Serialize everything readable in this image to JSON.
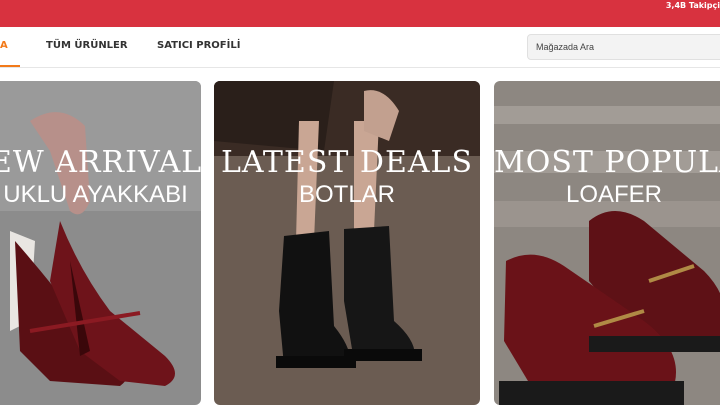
{
  "header": {
    "followers": "3,4B Takipçi",
    "brand_color": "#d8323f",
    "accent_color": "#f27a1a"
  },
  "nav": {
    "tabs": [
      {
        "label": "A",
        "active": true
      },
      {
        "label": "TÜM ÜRÜNLER",
        "active": false
      },
      {
        "label": "SATICI PROFİLİ",
        "active": false
      }
    ]
  },
  "search": {
    "placeholder": "Mağazada Ara"
  },
  "banners": [
    {
      "title": "EW ARRIVAL",
      "subtitle": "UKLU AYAKKABI"
    },
    {
      "title": "LATEST DEALS",
      "subtitle": "BOTLAR"
    },
    {
      "title": "MOST POPULA",
      "subtitle": "LOAFER"
    }
  ]
}
